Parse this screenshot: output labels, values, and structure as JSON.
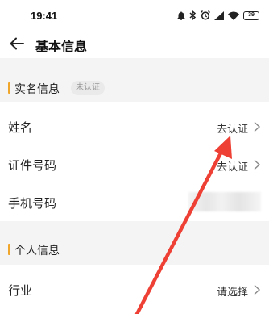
{
  "status_bar": {
    "time": "19:41",
    "battery": "39",
    "icons": [
      "notification-icon",
      "bluetooth-icon",
      "alarm-icon",
      "signal-icon",
      "wifi-icon",
      "battery-icon"
    ]
  },
  "nav": {
    "title": "基本信息",
    "back_icon": "back-arrow-icon"
  },
  "sections": {
    "realname": {
      "title": "实名信息",
      "badge": "未认证",
      "rows": [
        {
          "label": "姓名",
          "value": "去认证"
        },
        {
          "label": "证件号码",
          "value": "去认证"
        },
        {
          "label": "手机号码",
          "value": ""
        }
      ]
    },
    "personal": {
      "title": "个人信息",
      "rows": [
        {
          "label": "行业",
          "value": "请选择"
        }
      ]
    }
  },
  "colors": {
    "accent": "#f0a52b",
    "annotation_arrow": "#ee4035",
    "section_bg": "#f4f4f4"
  }
}
